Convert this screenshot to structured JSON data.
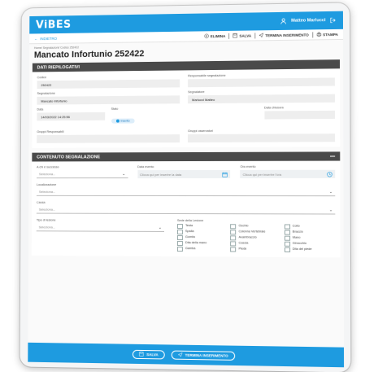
{
  "app": {
    "logo": "ViBES",
    "user": "Matteo Marlucci"
  },
  "toolbar": {
    "back_label": "INDIETRO",
    "elimina": "ELIMINA",
    "salva": "SALVA",
    "termina": "TERMINA INSERIMENTO",
    "stampa": "STAMPA"
  },
  "breadcrumb": "Home/ Segnalazioni/ Codice 252422",
  "page_title": "Mancato Infortunio 252422",
  "riepilogo": {
    "header": "DATI RIEPILOGATIVI",
    "codice_label": "Codice",
    "codice_value": "252422",
    "responsabile_label": "Responsabile segnalazione",
    "responsabile_value": "",
    "segnalazione_label": "Segnalazione",
    "segnalazione_value": "Mancato Infortunio",
    "segnalatore_label": "Segnalatore",
    "segnalatore_value": "Marlucci Matteo",
    "data_label": "Data",
    "data_value": "14/03/2022 14:25:56",
    "stato_label": "Stato",
    "stato_value": "Inserito",
    "chiusura_label": "Data chiusura",
    "chiusura_value": "",
    "gruppi_resp_label": "Gruppi Responsabili",
    "gruppi_oss_label": "Gruppi osservatori"
  },
  "contenuto": {
    "header": "CONTENUTO SEGNALAZIONE",
    "a_chi_label": "A chi è successo",
    "a_chi_placeholder": "Seleziona...",
    "data_evento_label": "Data evento",
    "data_evento_placeholder": "Clicca qui per inserire la data",
    "ora_evento_label": "Ora evento",
    "ora_evento_placeholder": "Clicca qui per inserire l'ora",
    "localizzazione_label": "Localizzazione",
    "localizzazione_placeholder": "Seleziona...",
    "causa_label": "Causa",
    "causa_placeholder": "Seleziona...",
    "tipo_lesione_label": "Tipo di lesione",
    "tipo_lesione_placeholder": "Seleziona...",
    "sede_label": "Sede della Lesione",
    "sede_items": [
      "Testa",
      "Occhio",
      "Collo",
      "Spalla",
      "Colonna Vertebrale",
      "Braccio",
      "Gomito",
      "Avambraccio",
      "Mano",
      "Dita della mano",
      "Coscia",
      "Ginocchio",
      "Gamba",
      "Piede",
      "Dita del piede"
    ]
  },
  "footer": {
    "salva": "SALVA",
    "termina": "TERMINA INSERIMENTO"
  },
  "colors": {
    "accent": "#1e9be0",
    "section_header": "#4a4a4a"
  }
}
